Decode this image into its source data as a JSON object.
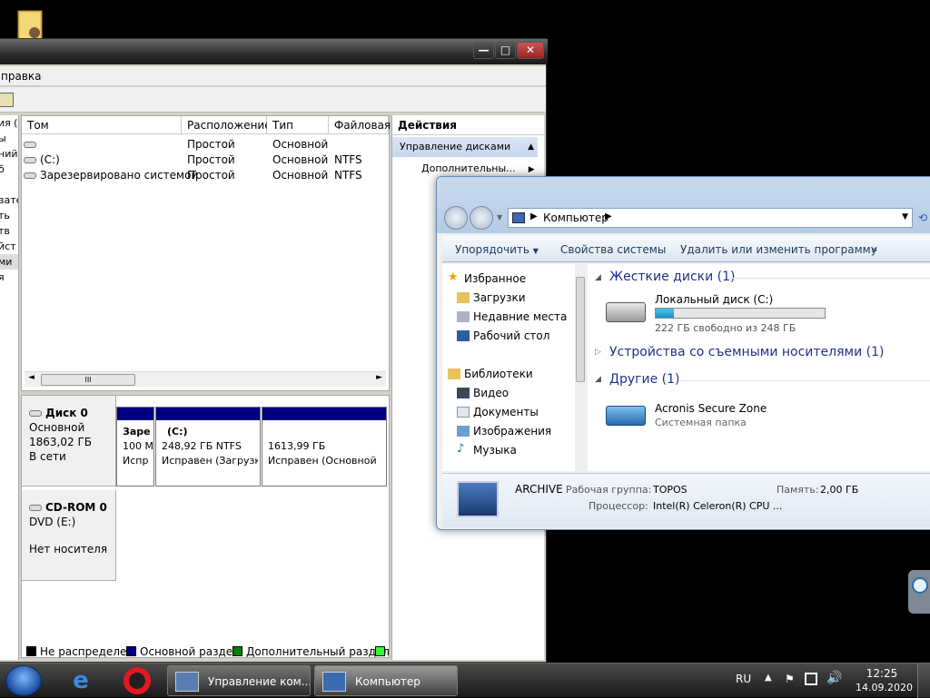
{
  "disk_mgmt": {
    "menu_fragment": "правка",
    "list_headers": [
      "Том",
      "Расположение",
      "Тип",
      "Файловая"
    ],
    "volumes": [
      {
        "name": "",
        "layout": "Простой",
        "type": "Основной",
        "fs": ""
      },
      {
        "name": "(C:)",
        "layout": "Простой",
        "type": "Основной",
        "fs": "NTFS"
      },
      {
        "name": "Зарезервировано системой",
        "layout": "Простой",
        "type": "Основной",
        "fs": "NTFS"
      }
    ],
    "left_tree_fragments": [
      "ия (л",
      "ы",
      "ний",
      "б",
      "",
      "вате",
      "ть",
      "тв",
      "йст",
      "ми",
      "я"
    ],
    "hscroll_glyph": "III",
    "disk0": {
      "label": "Диск 0",
      "type": "Основной",
      "size": "1863,02 ГБ",
      "status": "В сети"
    },
    "partitions": [
      {
        "line1": "Заре",
        "line2": "100 М",
        "line3": "Испр"
      },
      {
        "line1": "(C:)",
        "line2": "248,92 ГБ NTFS",
        "line3": "Исправен (Загрузк"
      },
      {
        "line1": "",
        "line2": "1613,99 ГБ",
        "line3": "Исправен (Основной"
      }
    ],
    "cdrom": {
      "label": "CD-ROM 0",
      "drive": "DVD (E:)",
      "status": "Нет носителя"
    },
    "actions_title": "Действия",
    "actions_section": "Управление дисками",
    "actions_more": "Дополнительны...",
    "legend": [
      "Не распределен",
      "Основной раздел",
      "Дополнительный раздел"
    ],
    "legend_colors": [
      "#000000",
      "#000080",
      "#008000",
      "#33ff33"
    ]
  },
  "explorer": {
    "address": "Компьютер",
    "commands": [
      "Упорядочить",
      "Свойства системы",
      "Удалить или изменить программу",
      "»"
    ],
    "nav": [
      {
        "label": "Избранное",
        "icon": "star-icon"
      },
      {
        "label": "Загрузки",
        "icon": "folder-icon"
      },
      {
        "label": "Недавние места",
        "icon": "recent-icon"
      },
      {
        "label": "Рабочий стол",
        "icon": "desktop-icon"
      },
      {
        "label": "Библиотеки",
        "icon": "library-icon"
      },
      {
        "label": "Видео",
        "icon": "video-icon"
      },
      {
        "label": "Документы",
        "icon": "documents-icon"
      },
      {
        "label": "Изображения",
        "icon": "pictures-icon"
      },
      {
        "label": "Музыка",
        "icon": "music-icon"
      }
    ],
    "groups": {
      "hdd": "Жесткие диски (1)",
      "removable": "Устройства со съемными носителями (1)",
      "other": "Другие (1)"
    },
    "local_disk": {
      "name": "Локальный диск (C:)",
      "free": "222 ГБ свободно из 248 ГБ",
      "used_fraction": 0.105
    },
    "acronis": {
      "name": "Acronis Secure Zone",
      "desc": "Системная папка"
    },
    "details": {
      "computer": "ARCHIVE",
      "workgroup_label": "Рабочая группа:",
      "workgroup": "TOPOS",
      "memory_label": "Память:",
      "memory": "2,00 ГБ",
      "cpu_label": "Процессор:",
      "cpu": "Intel(R) Celeron(R) CPU ..."
    }
  },
  "taskbar": {
    "buttons": [
      "Управление ком...",
      "Компьютер"
    ],
    "lang": "RU",
    "time": "12:25",
    "date": "14.09.2020"
  }
}
